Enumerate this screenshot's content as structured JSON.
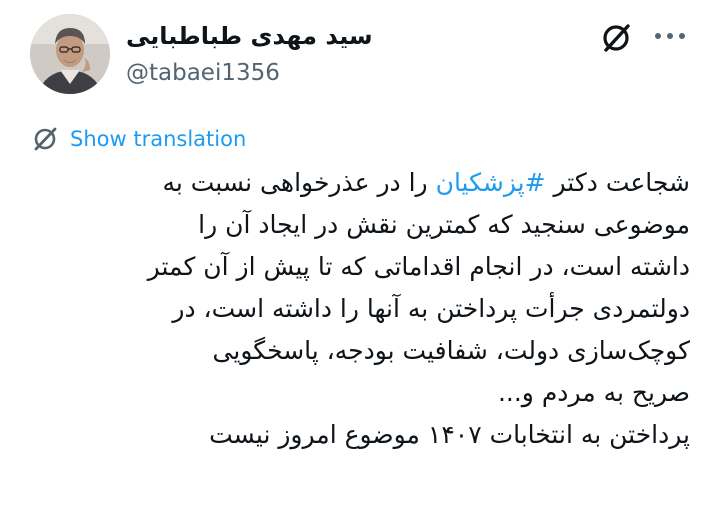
{
  "author": {
    "name": "سید مهدی طباطبایی",
    "handle": "@tabaei1356"
  },
  "icons": {
    "grok": "grok-icon",
    "more": "more-icon",
    "translate": "translate-icon"
  },
  "translate_label": "Show translation",
  "tweet": {
    "line1_before": "شجاعت دکتر ",
    "line1_hashtag": "#پزشکیان",
    "line1_after": " را در عذرخواهی نسبت به",
    "line2": "موضوعی سنجید که کمترین نقش در ایجاد آن را",
    "line3": "داشته است، در انجام اقداماتی که تا پیش از آن کمتر",
    "line4": "دولتمردی جرأت پرداختن به آنها را داشته است، در",
    "line5": "کوچک‌سازی دولت، شفافیت بودجه، پاسخگویی",
    "line6": "صریح به مردم و...",
    "line7": "پرداختن به انتخابات ۱۴۰۷ موضوع امروز نیست"
  },
  "colors": {
    "link": "#1d9bf0",
    "text": "#0f1419",
    "muted": "#536471"
  }
}
